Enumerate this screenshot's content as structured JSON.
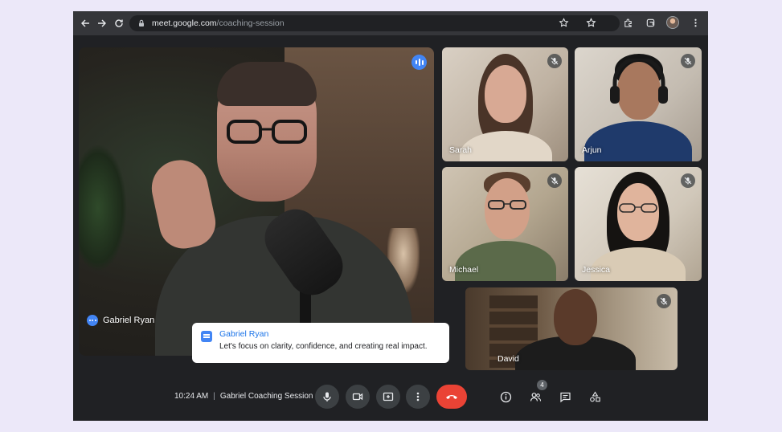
{
  "browser": {
    "url_host": "meet.google.com",
    "url_path": "/coaching-session"
  },
  "main_speaker": {
    "name": "Gabriel Ryan"
  },
  "caption": {
    "speaker": "Gabriel Ryan",
    "text": "Let's focus on clarity, confidence, and creating real impact."
  },
  "participants": [
    {
      "name": "Sarah",
      "muted": true
    },
    {
      "name": "Arjun",
      "muted": true
    },
    {
      "name": "Michael",
      "muted": true
    },
    {
      "name": "Jessica",
      "muted": true
    },
    {
      "name": "David",
      "muted": true
    }
  ],
  "bottom_bar": {
    "time": "10:24 AM",
    "separator": "|",
    "meeting_title": "Gabriel Coaching Session",
    "people_count": "4"
  },
  "colors": {
    "accent_blue": "#4285f4",
    "hangup_red": "#ea4335",
    "surface": "#202124",
    "button": "#3c4043"
  },
  "icons": [
    "back-arrow-icon",
    "forward-arrow-icon",
    "reload-icon",
    "lock-icon",
    "lens-icon",
    "bookmark-star-icon",
    "extension-icon",
    "profile-avatar",
    "kebab-menu-icon",
    "speaking-indicator-icon",
    "caption-icon",
    "mic-icon",
    "camera-icon",
    "present-icon",
    "more-options-icon",
    "hangup-icon",
    "info-icon",
    "people-icon",
    "chat-icon",
    "activities-icon",
    "mic-off-icon"
  ]
}
